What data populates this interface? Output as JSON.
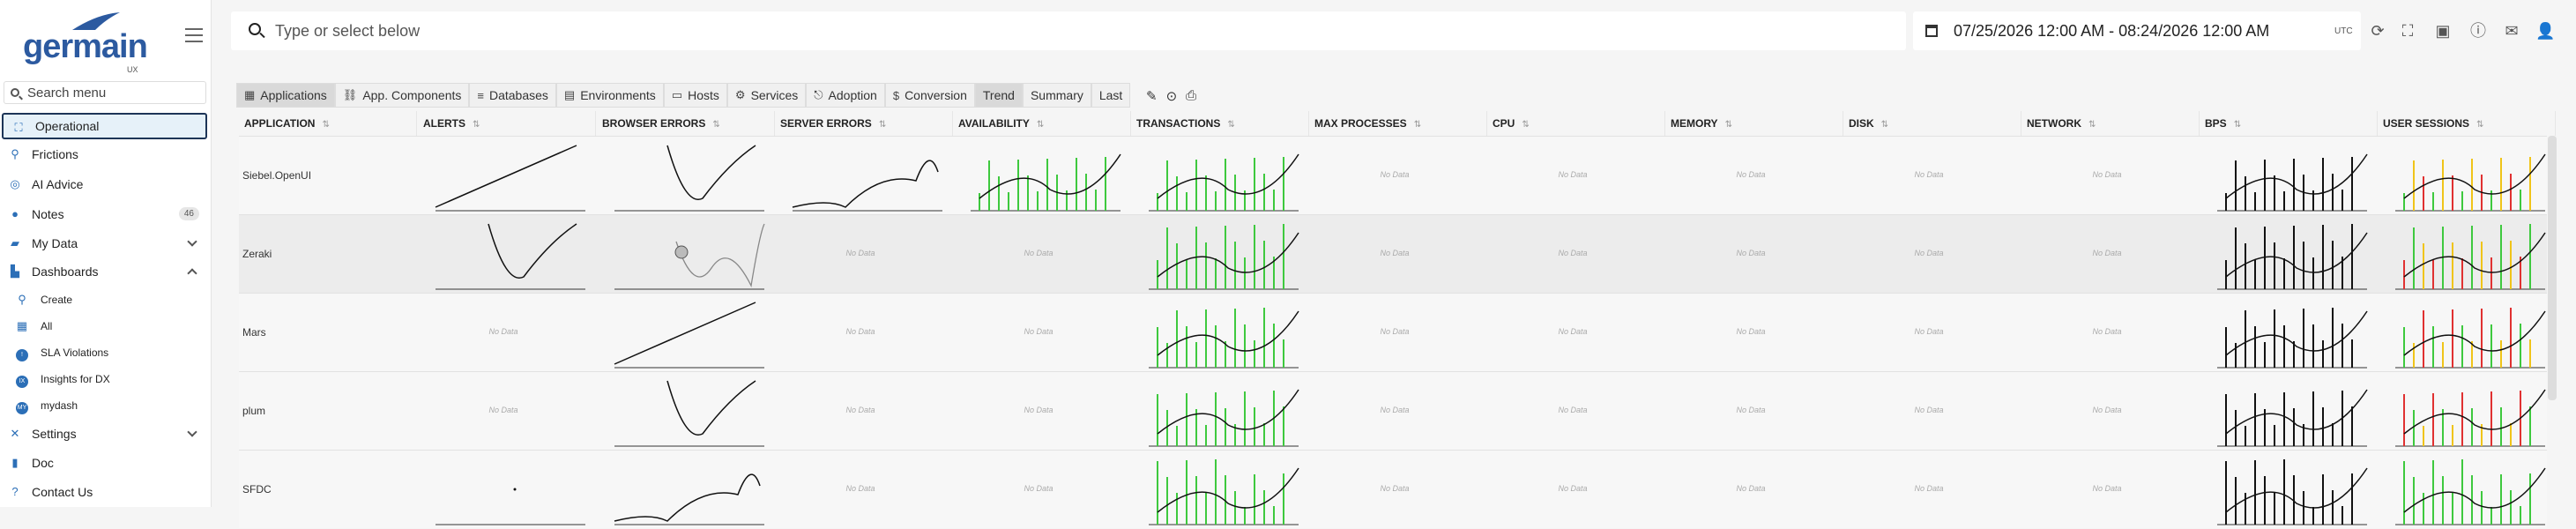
{
  "brand": {
    "name": "germain",
    "sub": "UX"
  },
  "sidebar": {
    "search_placeholder": "Search menu",
    "items": [
      {
        "label": "Operational",
        "icon": "sitemap-icon"
      },
      {
        "label": "Frictions",
        "icon": "route-icon"
      },
      {
        "label": "AI Advice",
        "icon": "ai-icon"
      },
      {
        "label": "Notes",
        "icon": "chat-icon",
        "badge": "46"
      },
      {
        "label": "My Data",
        "icon": "data-icon"
      },
      {
        "label": "Dashboards",
        "icon": "chart-icon"
      },
      {
        "label": "Create",
        "icon": "search-icon"
      },
      {
        "label": "All",
        "icon": "grid-icon"
      },
      {
        "label": "SLA Violations",
        "icon": "alert-icon"
      },
      {
        "label": "Insights for DX",
        "icon": "insight-icon"
      },
      {
        "label": "mydash",
        "icon": "user-icon"
      },
      {
        "label": "Settings",
        "icon": "settings-icon"
      },
      {
        "label": "Doc",
        "icon": "book-icon"
      },
      {
        "label": "Contact Us",
        "icon": "question-icon"
      }
    ]
  },
  "search": {
    "placeholder": "Type or select below"
  },
  "daterange": {
    "text": "07/25/2026 12:00 AM - 08:24/2026 12:00 AM",
    "tz": "UTC"
  },
  "tabs": [
    {
      "label": "Applications",
      "icon": "▦",
      "selected": true
    },
    {
      "label": "App. Components",
      "icon": "⛓"
    },
    {
      "label": "Databases",
      "icon": "≡"
    },
    {
      "label": "Environments",
      "icon": "▤"
    },
    {
      "label": "Hosts",
      "icon": "▭"
    },
    {
      "label": "Services",
      "icon": "⚙"
    },
    {
      "label": "Adoption",
      "icon": "⎋"
    },
    {
      "label": "Conversion",
      "icon": "$"
    },
    {
      "label": "Trend",
      "selected": true
    },
    {
      "label": "Summary"
    },
    {
      "label": "Last"
    }
  ],
  "columns": [
    "APPLICATION",
    "ALERTS",
    "BROWSER ERRORS",
    "SERVER ERRORS",
    "AVAILABILITY",
    "TRANSACTIONS",
    "MAX PROCESSES",
    "CPU",
    "MEMORY",
    "DISK",
    "NETWORK",
    "BPS",
    "USER SESSIONS"
  ],
  "no_data": "No Data",
  "rows": [
    {
      "name": "Siebel.OpenUI",
      "cells": [
        "line",
        "line",
        "line",
        "green",
        "green",
        "none",
        "none",
        "none",
        "none",
        "none",
        "black",
        "mixed"
      ]
    },
    {
      "name": "Zeraki",
      "cells": [
        "line",
        "zoom",
        "none",
        "none",
        "green",
        "none",
        "none",
        "none",
        "none",
        "none",
        "black",
        "red"
      ]
    },
    {
      "name": "Mars",
      "cells": [
        "none",
        "line",
        "none",
        "none",
        "green",
        "none",
        "none",
        "none",
        "none",
        "none",
        "black",
        "mixed"
      ]
    },
    {
      "name": "plum",
      "cells": [
        "none",
        "line",
        "none",
        "none",
        "green",
        "none",
        "none",
        "none",
        "none",
        "none",
        "black",
        "red"
      ]
    },
    {
      "name": "SFDC",
      "cells": [
        "dot",
        "line",
        "none",
        "none",
        "green",
        "none",
        "none",
        "none",
        "none",
        "none",
        "black",
        "green"
      ]
    }
  ],
  "colors": {
    "accent": "#2c6fb7",
    "active_border": "#1d3557",
    "green": "#3ec93e",
    "red": "#e03131",
    "yellow": "#f0c419"
  }
}
